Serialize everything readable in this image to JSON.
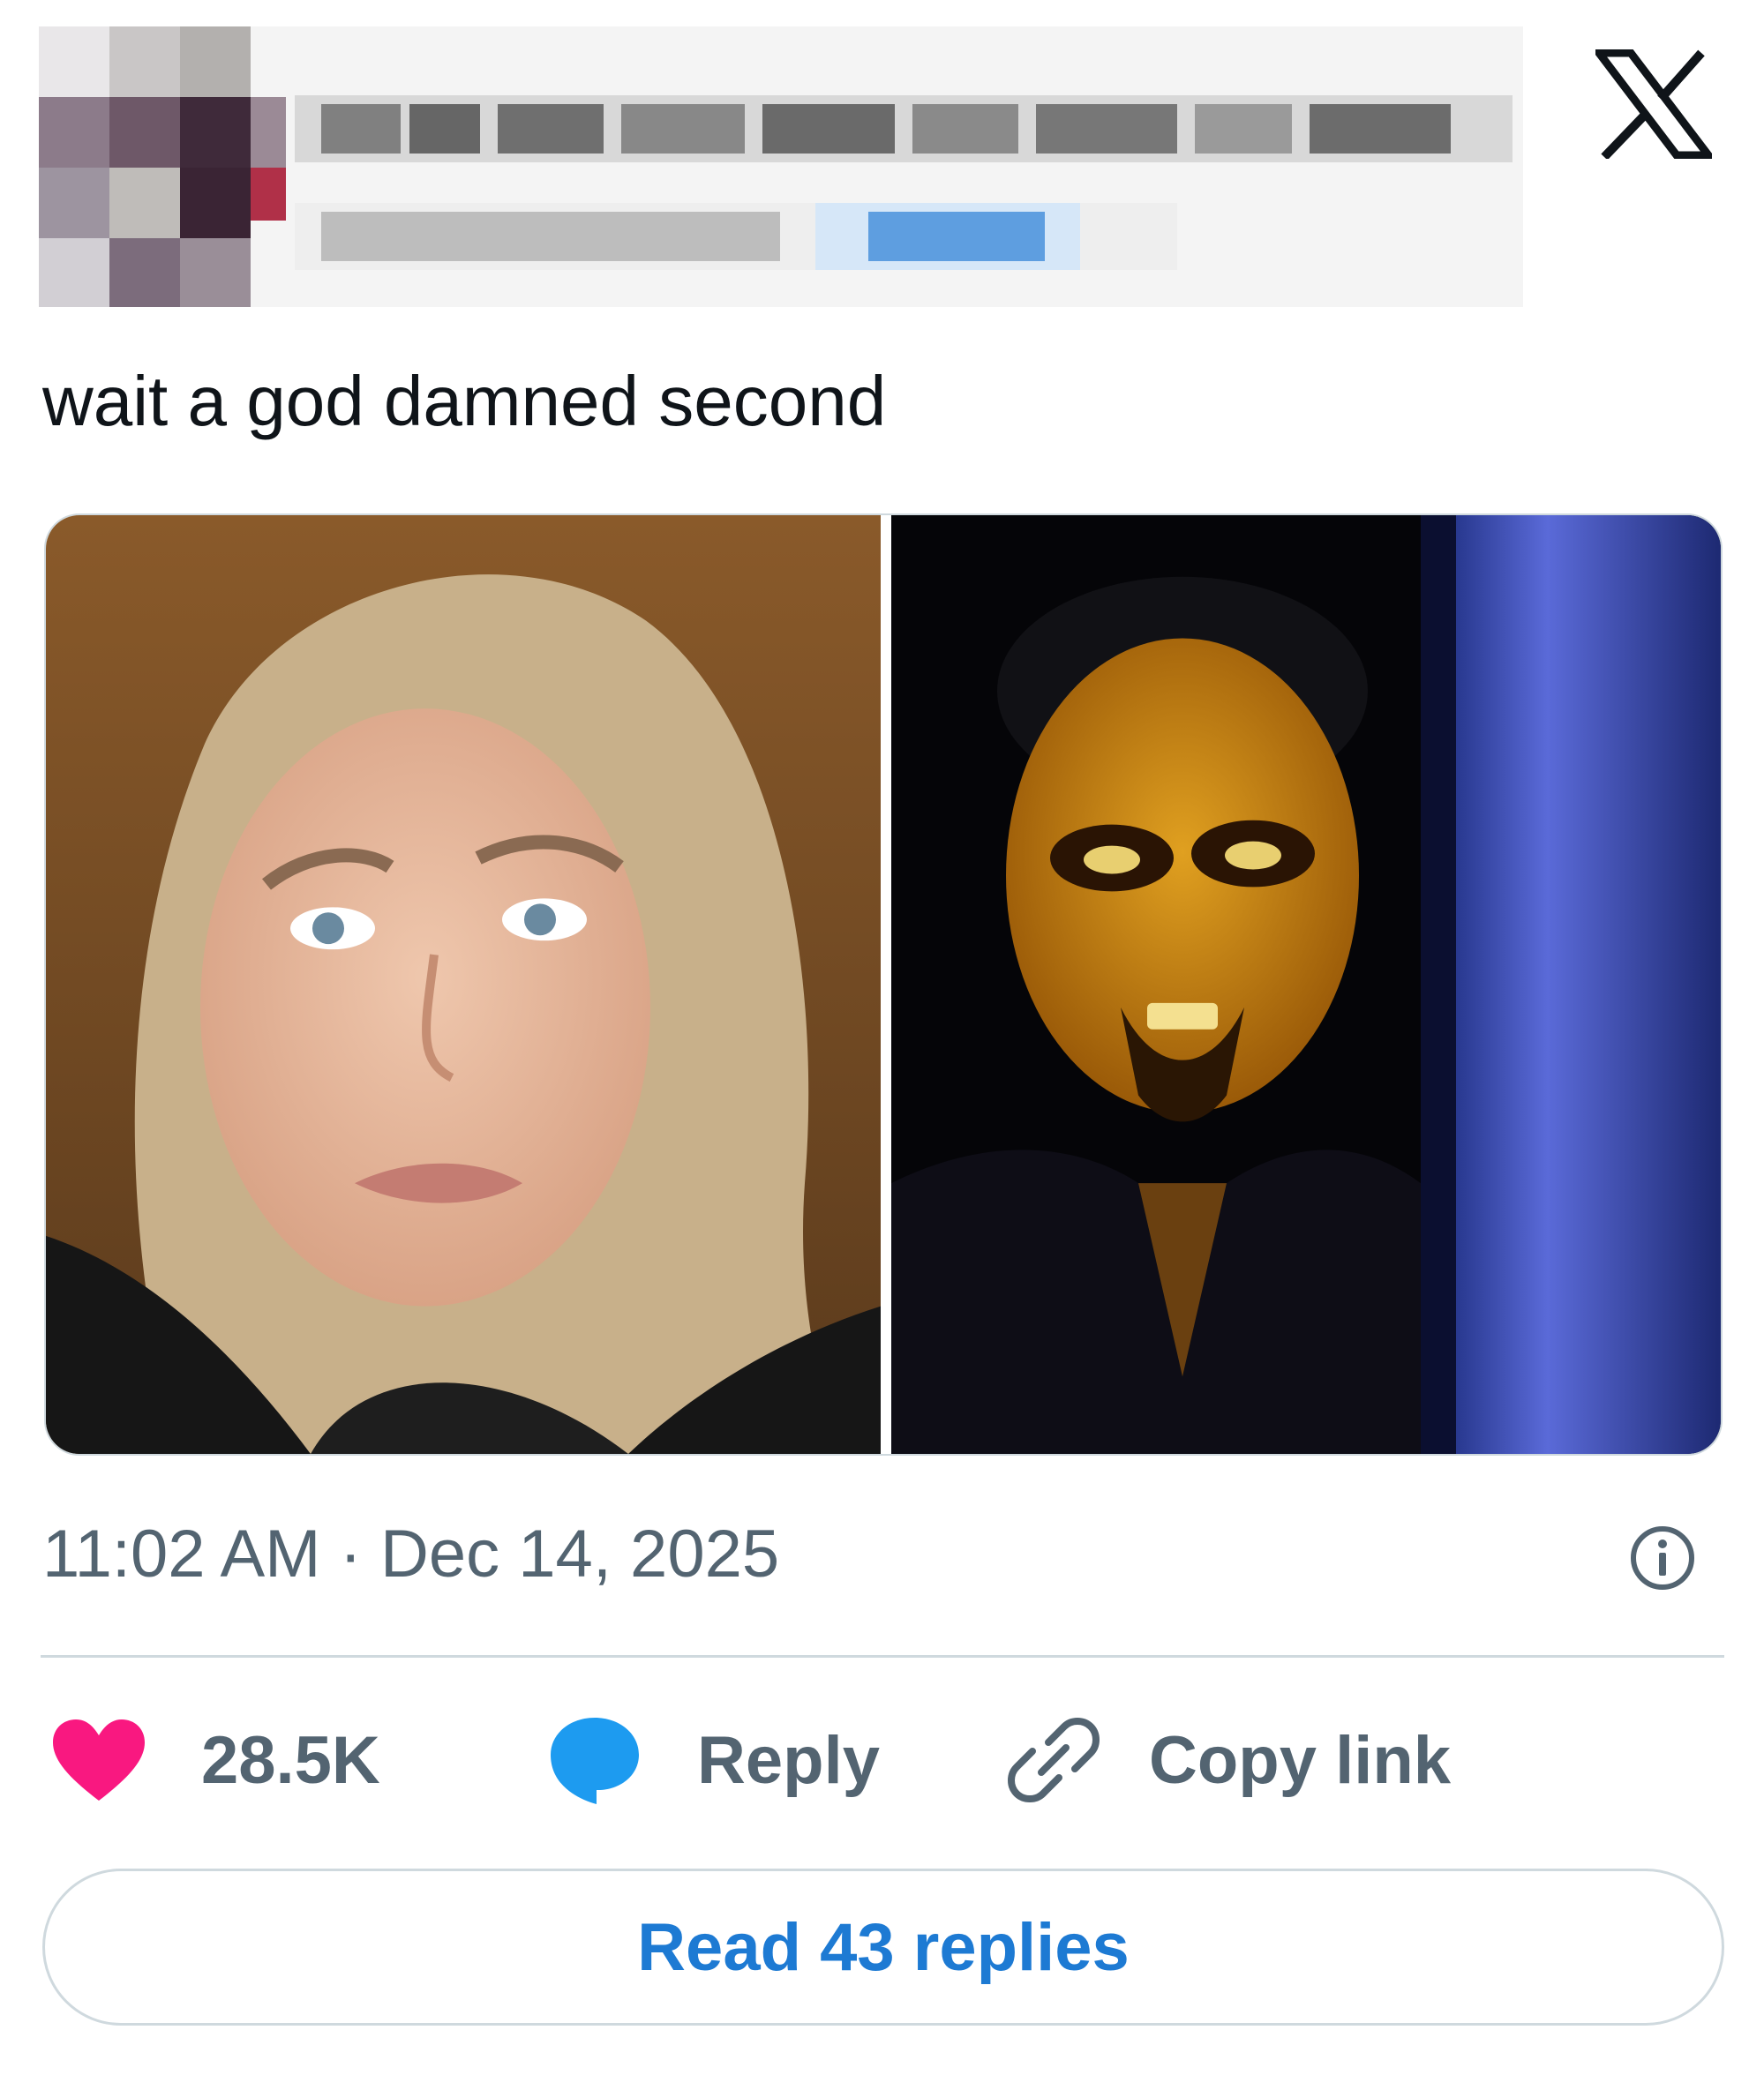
{
  "brand": {
    "logo_icon": "x-logo-icon",
    "logo_text": "X"
  },
  "tweet": {
    "text": "wait a god damned second",
    "author_blurred": true,
    "time": "11:02 AM",
    "separator": " · ",
    "date": "Dec 14, 2025",
    "media": [
      {
        "name": "left-photo",
        "description_icon": "photo"
      },
      {
        "name": "right-photo",
        "description_icon": "photo"
      }
    ]
  },
  "actions": {
    "like": {
      "icon": "heart-icon",
      "count": "28.5K",
      "color": "#f91880"
    },
    "reply": {
      "icon": "speech-bubble-icon",
      "label": "Reply",
      "color": "#1d9bf0"
    },
    "copy": {
      "icon": "link-icon",
      "label": "Copy link"
    }
  },
  "replies_button": {
    "label": "Read 43 replies"
  },
  "colors": {
    "text": "#0f1419",
    "muted": "#536471",
    "border": "#cfd9de",
    "link": "#1d7ad3"
  }
}
